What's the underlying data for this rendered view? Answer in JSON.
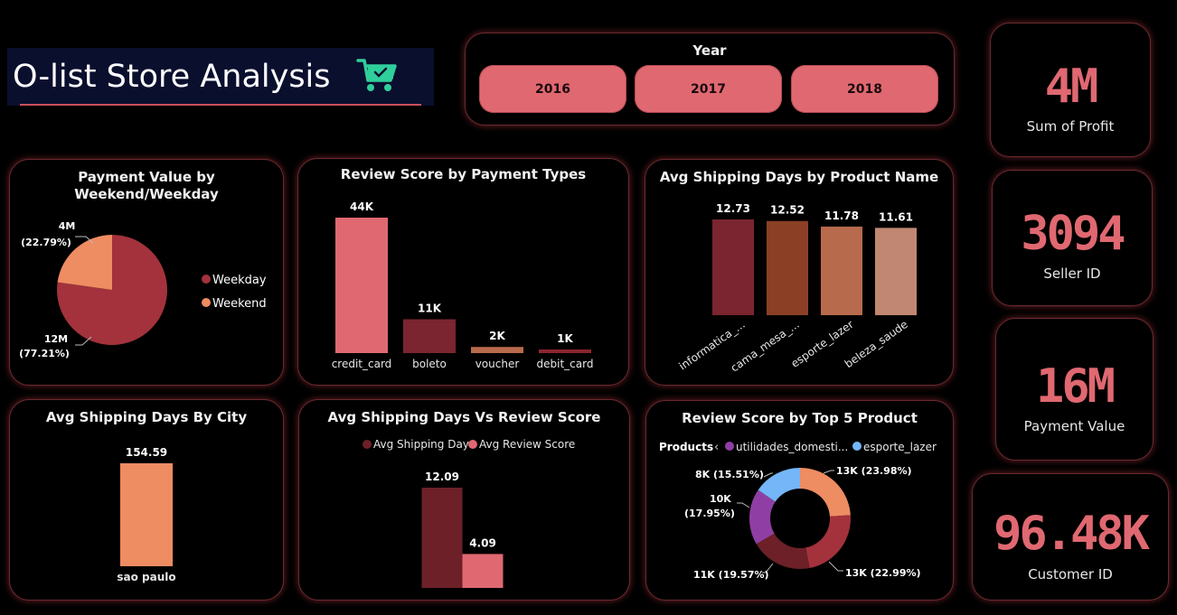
{
  "header": {
    "title": "O-list Store Analysis",
    "icon": "shopping-cart-check-icon"
  },
  "year_filter": {
    "title": "Year",
    "buttons": [
      "2016",
      "2017",
      "2018"
    ]
  },
  "kpis": {
    "profit": {
      "value": "4M",
      "label": "Sum of Profit"
    },
    "seller": {
      "value": "3094",
      "label": "Seller ID"
    },
    "payment": {
      "value": "16M",
      "label": "Payment Value"
    },
    "customer": {
      "value": "96.48K",
      "label": "Customer ID"
    }
  },
  "colors": {
    "accent": "#e06871",
    "dark_red": "#a3323c",
    "orange": "#ee8c62",
    "maroon": "#7a2530",
    "brown": "#8b4025",
    "terracotta": "#b86a4c",
    "tan": "#c18772",
    "purple": "#8f3fa3",
    "blue": "#74b6f7"
  },
  "chart_data": [
    {
      "id": "payment_weekday",
      "type": "pie",
      "title": "Payment Value by Weekend/Weekday",
      "title_lines": [
        "Payment Value by",
        "Weekend/Weekday"
      ],
      "legend": [
        "Weekday",
        "Weekend"
      ],
      "values": [
        12,
        4
      ],
      "labels": [
        "12M",
        "4M"
      ],
      "percents": [
        "(77.21%)",
        "(22.79%)"
      ],
      "percent_values": [
        77.21,
        22.79
      ],
      "colors": [
        "#a3323c",
        "#ee8c62"
      ]
    },
    {
      "id": "review_payment",
      "type": "bar",
      "title": "Review Score by Payment Types",
      "categories": [
        "credit_card",
        "boleto",
        "voucher",
        "debit_card"
      ],
      "values": [
        44,
        11,
        2,
        1
      ],
      "data_labels": [
        "44K",
        "11K",
        "2K",
        "1K"
      ],
      "colors": [
        "#e06871",
        "#7a2530",
        "#b86a4c",
        "#8b2530"
      ],
      "ylim": [
        0,
        44
      ]
    },
    {
      "id": "shipping_product",
      "type": "bar",
      "title": "Avg Shipping Days by Product Name",
      "categories": [
        "informatica_...",
        "cama_mesa_...",
        "esporte_lazer",
        "beleza_saude"
      ],
      "values": [
        12.73,
        12.52,
        11.78,
        11.61
      ],
      "data_labels": [
        "12.73",
        "12.52",
        "11.78",
        "11.61"
      ],
      "colors": [
        "#7a2530",
        "#8b4025",
        "#b86a4c",
        "#c18772"
      ],
      "ylim": [
        0,
        12.73
      ]
    },
    {
      "id": "shipping_city",
      "type": "bar",
      "title": "Avg Shipping Days By City",
      "categories": [
        "sao paulo"
      ],
      "values": [
        154.59
      ],
      "data_labels": [
        "154.59"
      ],
      "colors": [
        "#ee8c62"
      ],
      "ylim": [
        0,
        154.59
      ]
    },
    {
      "id": "shipping_vs_review",
      "type": "bar",
      "title": "Avg Shipping Days Vs Review Score",
      "categories": [
        ""
      ],
      "series": [
        {
          "name": "Avg Shipping Days",
          "values": [
            12.09
          ],
          "label": "12.09",
          "color": "#6d2028"
        },
        {
          "name": "Avg Review Score",
          "values": [
            4.09
          ],
          "label": "4.09",
          "color": "#e06871"
        }
      ],
      "ylim": [
        0,
        12.09
      ]
    },
    {
      "id": "review_top5",
      "type": "pie",
      "title": "Review Score by Top 5 Product",
      "legend_title": "Products",
      "legend": [
        "utilidades_domesti...",
        "esporte_lazer"
      ],
      "legend_colors": [
        "#8f3fa3",
        "#74b6f7"
      ],
      "values": [
        13,
        13,
        11,
        10,
        8
      ],
      "labels": [
        "13K (23.98%)",
        "13K (22.99%)",
        "11K (19.57%)",
        "10K",
        "8K (15.51%)"
      ],
      "label_extra": [
        "",
        "",
        "",
        "(17.95%)",
        ""
      ],
      "percent_values": [
        23.98,
        22.99,
        19.57,
        17.95,
        15.51
      ],
      "colors": [
        "#ee8c62",
        "#a3323c",
        "#6d2028",
        "#8f3fa3",
        "#74b6f7"
      ]
    }
  ]
}
